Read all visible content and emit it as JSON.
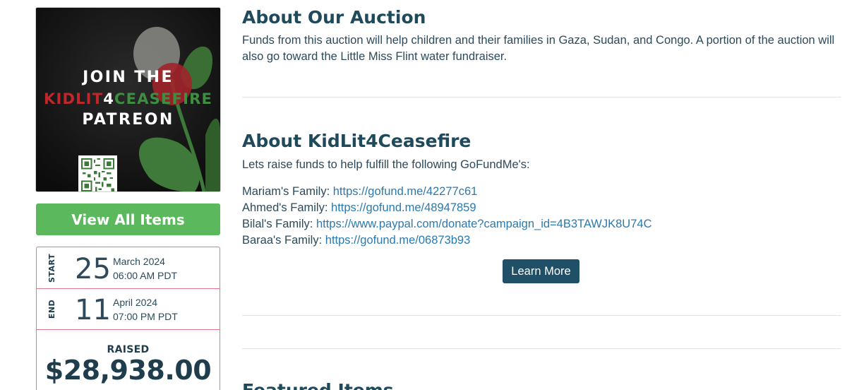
{
  "promo": {
    "line1": "JOIN THE",
    "line2_red": "KIDLIT",
    "line2_white": "4",
    "line2_green": "CEASEFIRE",
    "line3": "PATREON",
    "qr_icon": "qr-code-icon"
  },
  "sidebar": {
    "view_all_label": "View All Items",
    "start": {
      "side_label": "START",
      "day": "25",
      "month_year": "March 2024",
      "time": "06:00 AM PDT"
    },
    "end": {
      "side_label": "END",
      "day": "11",
      "month_year": "April 2024",
      "time": "07:00 PM PDT"
    },
    "raised_label": "RAISED",
    "raised_amount": "$28,938.00"
  },
  "about_auction": {
    "title": "About Our Auction",
    "text": "Funds from this auction will help children and their families in Gaza, Sudan, and Congo. A portion of the auction will also go toward the Little Miss Flint water fundraiser."
  },
  "about_kidlit": {
    "title": "About KidLit4Ceasefire",
    "intro": "Lets raise funds to help fulfill the following GoFundMe's:",
    "families": [
      {
        "label": "Mariam's Family:",
        "link": "https://gofund.me/42277c61"
      },
      {
        "label": "Ahmed's Family:",
        "link": "https://gofund.me/48947859"
      },
      {
        "label": "Bilal's Family:",
        "link": "https://www.paypal.com/donate?campaign_id=4B3TAWJK8U74C"
      },
      {
        "label": "Baraa's Family:",
        "link": "https://gofund.me/06873b93"
      }
    ],
    "learn_more_label": "Learn More"
  },
  "featured": {
    "title": "Featured Items"
  },
  "colors": {
    "green_button": "#5cb85c",
    "dark_button": "#1f5068",
    "heading": "#1f4a5c",
    "link": "#2a7ab0",
    "box_border": "#e2788a"
  }
}
